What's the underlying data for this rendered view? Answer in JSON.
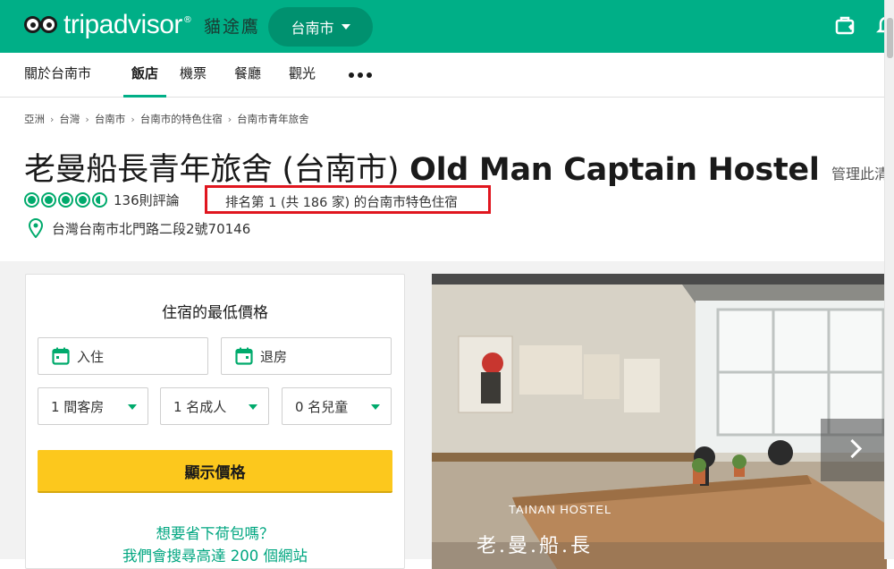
{
  "header": {
    "logo_text": "tripadvisor",
    "logo_tm": "®",
    "logo_cn": "貓途鷹",
    "location": "台南市",
    "brand_color": "#00af87"
  },
  "nav": {
    "items": [
      {
        "label": "關於台南市",
        "active": false
      },
      {
        "label": "飯店",
        "active": true
      },
      {
        "label": "機票",
        "active": false
      },
      {
        "label": "餐廳",
        "active": false
      },
      {
        "label": "觀光",
        "active": false
      }
    ]
  },
  "breadcrumb": {
    "items": [
      "亞洲",
      "台灣",
      "台南市",
      "台南市的特色住宿",
      "台南市青年旅舍"
    ],
    "separator": "›"
  },
  "hotel": {
    "title_cn": "老曼船長青年旅舍 (台南市)",
    "title_en": "Old Man Captain Hostel",
    "manage": "管理此清",
    "rating": 4.5,
    "reviews": "136則評論",
    "ranking": "排名第 1 (共 186 家) 的台南市特色住宿",
    "address": "台灣台南市北門路二段2號70146"
  },
  "booking": {
    "title": "住宿的最低價格",
    "checkin_placeholder": "入住",
    "checkout_placeholder": "退房",
    "rooms": "1 間客房",
    "adults": "1 名成人",
    "children": "0 名兒童",
    "show_prices": "顯示價格",
    "save_question": "想要省下荷包嗎？",
    "save_sub": "我們會搜尋高達 200 個網站",
    "button_color": "#fcc81d"
  },
  "photo": {
    "label": "TAINAN HOSTEL",
    "sign": "老.曼.船.長"
  }
}
